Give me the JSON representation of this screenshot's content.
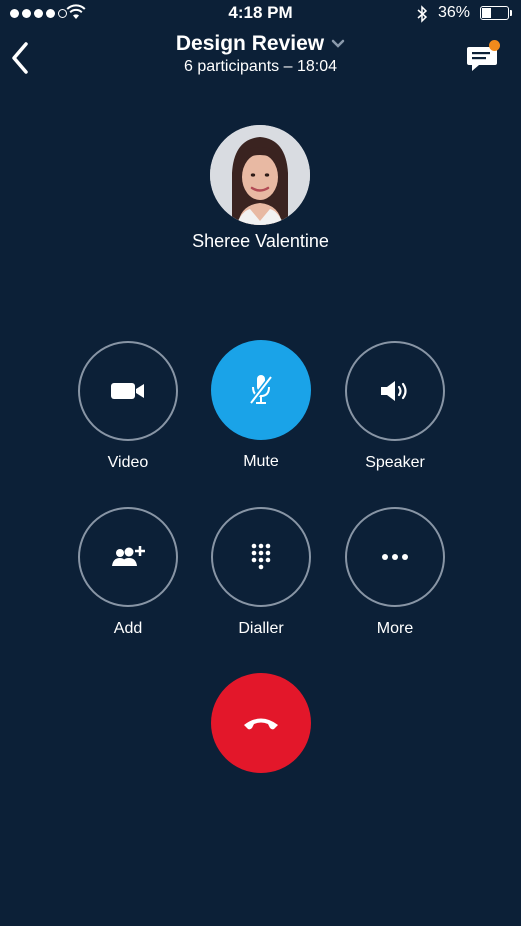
{
  "status_bar": {
    "time": "4:18 PM",
    "battery_percent": "36%",
    "battery_level": 0.36,
    "signal_bars": 4,
    "icons": [
      "signal-dots-icon",
      "wifi-icon",
      "bluetooth-icon",
      "battery-icon"
    ]
  },
  "header": {
    "title": "Design Review",
    "subtitle": "6 participants – 18:04",
    "back_icon": "chevron-left-icon",
    "dropdown_icon": "chevron-down-icon",
    "chat_icon": "chat-bubble-icon",
    "chat_badge_color": "#f08a1c"
  },
  "participant": {
    "name": "Sheree Valentine"
  },
  "controls": {
    "video": {
      "label": "Video",
      "icon": "video-camera-icon"
    },
    "mute": {
      "label": "Mute",
      "icon": "microphone-muted-icon",
      "active": true
    },
    "speaker": {
      "label": "Speaker",
      "icon": "speaker-icon"
    },
    "add": {
      "label": "Add",
      "icon": "add-participant-icon"
    },
    "dialler": {
      "label": "Dialler",
      "icon": "dialpad-icon"
    },
    "more": {
      "label": "More",
      "icon": "more-dots-icon"
    }
  },
  "end_call": {
    "icon": "hang-up-icon",
    "color": "#e3172a"
  },
  "colors": {
    "background": "#0c2037",
    "accent": "#1aa3e8",
    "ring": "#8895a5"
  }
}
